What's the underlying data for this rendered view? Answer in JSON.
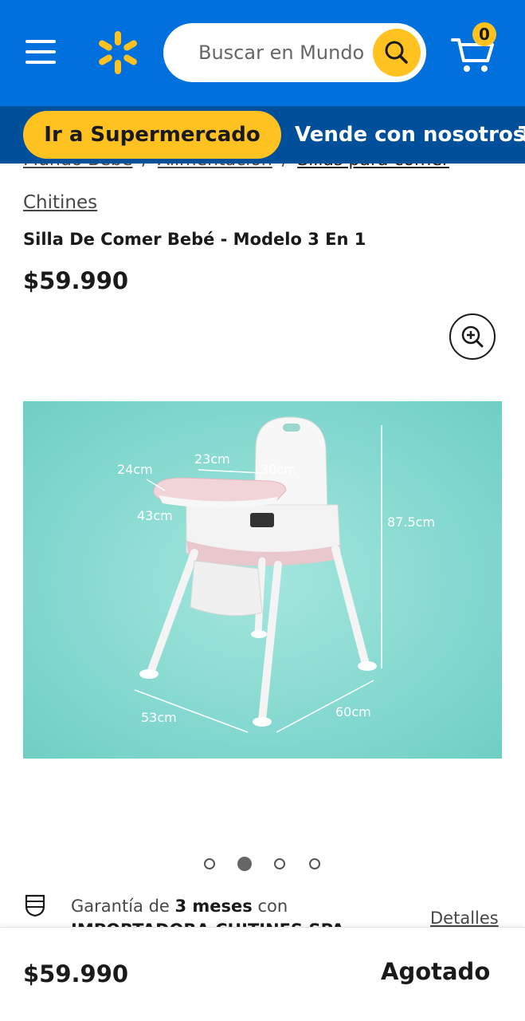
{
  "header": {
    "menu_icon": "hamburger-menu-icon",
    "logo_icon": "walmart-spark-icon",
    "search_placeholder": "Buscar en Mundo",
    "search_icon": "search-icon",
    "cart_icon": "cart-icon",
    "cart_count": "0",
    "colors": {
      "bar": "#0071dc",
      "accent": "#ffc220"
    }
  },
  "subnav": {
    "supermarket_label": "Ir a Supermercado",
    "sell_label": "Vende con nosotros",
    "more_label": "T",
    "color": "#004f9a"
  },
  "breadcrumb": [
    "Mundo Bebé",
    "Alimentación",
    "Sillas para comer"
  ],
  "breadcrumb_separator": "/",
  "product": {
    "brand": "Chitines",
    "title": "Silla De Comer Bebé - Modelo 3 En 1",
    "price": "$59.990",
    "zoom_icon": "zoom-in-icon",
    "image": {
      "dimensions": [
        "24cm",
        "23cm",
        "30cm",
        "43cm",
        "87.5cm",
        "53cm",
        "60cm"
      ],
      "background": "#7fd6cd"
    },
    "carousel": {
      "total": 4,
      "active_index": 1
    }
  },
  "warranty": {
    "icon": "shield-warranty-icon",
    "prefix": "Garantía de ",
    "duration": "3 meses",
    "suffix": " con",
    "provider": "IMPORTADORA CHITINES SPA",
    "details_label": "Detalles"
  },
  "bottom_bar": {
    "price": "$59.990",
    "status": "Agotado"
  }
}
